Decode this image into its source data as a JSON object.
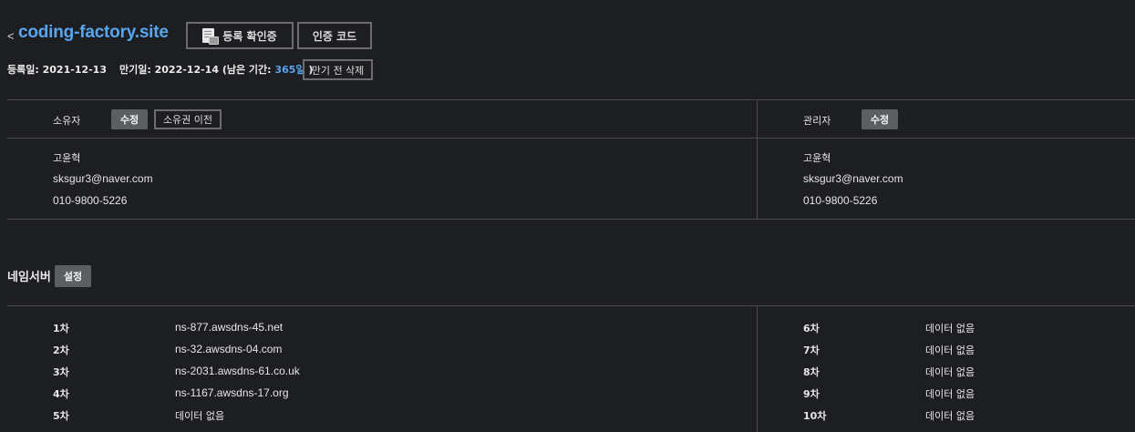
{
  "header": {
    "back_glyph": "<",
    "domain": "coding-factory.site",
    "register_confirm_label": "등록 확인증",
    "auth_code_label": "인증 코드"
  },
  "meta": {
    "registered_label": "등록일:",
    "registered_date": "2021-12-13",
    "expiry_label": "만기일:",
    "expiry_date": "2022-12-14",
    "remaining_prefix": "(남은 기간:",
    "remaining_days": "365일",
    "remaining_suffix": ")",
    "delete_before_expiry_label": "만기 전 삭제"
  },
  "owner": {
    "title": "소유자",
    "edit_label": "수정",
    "transfer_label": "소유권 이전",
    "name": "고윤혁",
    "email": "sksgur3@naver.com",
    "phone": "010-9800-5226"
  },
  "admin": {
    "title": "관리자",
    "edit_label": "수정",
    "name": "고윤혁",
    "email": "sksgur3@naver.com",
    "phone": "010-9800-5226"
  },
  "nameserver": {
    "title": "네임서버",
    "settings_label": "설정",
    "left": [
      {
        "index": "1차",
        "value": "ns-877.awsdns-45.net"
      },
      {
        "index": "2차",
        "value": "ns-32.awsdns-04.com"
      },
      {
        "index": "3차",
        "value": "ns-2031.awsdns-61.co.uk"
      },
      {
        "index": "4차",
        "value": "ns-1167.awsdns-17.org"
      },
      {
        "index": "5차",
        "value": "데이터 없음"
      }
    ],
    "right": [
      {
        "index": "6차",
        "value": "데이터 없음"
      },
      {
        "index": "7차",
        "value": "데이터 없음"
      },
      {
        "index": "8차",
        "value": "데이터 없음"
      },
      {
        "index": "9차",
        "value": "데이터 없음"
      },
      {
        "index": "10차",
        "value": "데이터 없음"
      }
    ]
  },
  "colors": {
    "background": "#1d1e21",
    "accent": "#58a6f0",
    "button_solid": "#5c5f62",
    "divider": "#4a4a4c"
  }
}
